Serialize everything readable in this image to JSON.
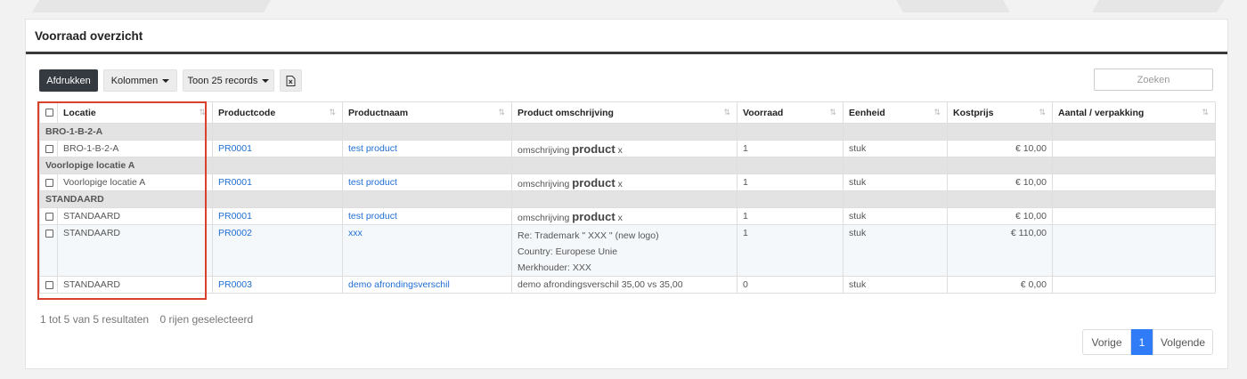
{
  "card": {
    "title": "Voorraad overzicht"
  },
  "toolbar": {
    "print_label": "Afdrukken",
    "columns_label": "Kolommen",
    "records_label": "Toon 25 records",
    "search_placeholder": "Zoeken",
    "search_value": ""
  },
  "table": {
    "headers": [
      "Locatie",
      "Productcode",
      "Productnaam",
      "Product omschrijving",
      "Voorraad",
      "Eenheid",
      "Kostprijs",
      "Aantal / verpakking"
    ],
    "groups": [
      {
        "name": "BRO-1-B-2-A",
        "rows": [
          {
            "locatie": "BRO-1-B-2-A",
            "code": "PR0001",
            "naam": "test product",
            "omschrijving_prefix": "omschrijving",
            "omschrijving_bold": "product",
            "omschrijving_suffix": "x",
            "voorraad": "1",
            "eenheid": "stuk",
            "kostprijs": "€ 10,00",
            "aantal": ""
          }
        ]
      },
      {
        "name": "Voorlopige locatie A",
        "rows": [
          {
            "locatie": "Voorlopige locatie A",
            "code": "PR0001",
            "naam": "test product",
            "omschrijving_prefix": "omschrijving",
            "omschrijving_bold": "product",
            "omschrijving_suffix": "x",
            "voorraad": "1",
            "eenheid": "stuk",
            "kostprijs": "€ 10,00",
            "aantal": ""
          }
        ]
      },
      {
        "name": "STANDAARD",
        "rows": [
          {
            "locatie": "STANDAARD",
            "code": "PR0001",
            "naam": "test product",
            "omschrijving_prefix": "omschrijving",
            "omschrijving_bold": "product",
            "omschrijving_suffix": "x",
            "voorraad": "1",
            "eenheid": "stuk",
            "kostprijs": "€ 10,00",
            "aantal": ""
          },
          {
            "locatie": "STANDAARD",
            "code": "PR0002",
            "naam": "xxx",
            "omschrijving_lines": [
              "Re: Trademark \" XXX \" (new logo)",
              "Country: Europese Unie",
              "Merkhouder: XXX"
            ],
            "voorraad": "1",
            "eenheid": "stuk",
            "kostprijs": "€ 110,00",
            "aantal": ""
          },
          {
            "locatie": "STANDAARD",
            "code": "PR0003",
            "naam": "demo afrondingsverschil",
            "omschrijving_plain": "demo afrondingsverschil 35,00 vs 35,00",
            "voorraad": "0",
            "eenheid": "stuk",
            "kostprijs": "€ 0,00",
            "aantal": ""
          }
        ]
      }
    ]
  },
  "footer": {
    "results_text": "1 tot 5 van 5 resultaten",
    "selected_text": "0 rijen geselecteerd"
  },
  "pagination": {
    "prev_label": "Vorige",
    "current_page": "1",
    "next_label": "Volgende"
  },
  "colors": {
    "highlight_box": "#d9412b",
    "link": "#1f6ed4",
    "active_page": "#2f7cf6",
    "dark_button": "#343a40"
  },
  "icons": {
    "export": "excel-export-icon",
    "sort": "sort-arrows-icon"
  }
}
